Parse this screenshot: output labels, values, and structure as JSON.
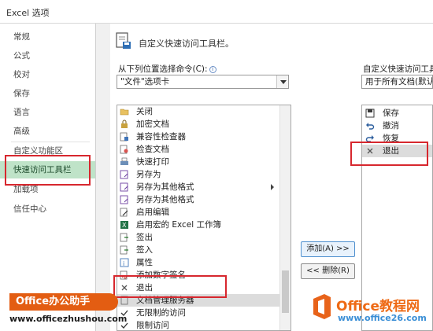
{
  "window": {
    "title": "Excel 选项"
  },
  "sidebar": {
    "items": [
      {
        "label": "常规"
      },
      {
        "label": "公式"
      },
      {
        "label": "校对"
      },
      {
        "label": "保存"
      },
      {
        "label": "语言"
      },
      {
        "label": "高级"
      },
      {
        "label": "自定义功能区"
      },
      {
        "label": "快速访问工具栏",
        "active": true
      },
      {
        "label": "加载项"
      },
      {
        "label": "信任中心"
      }
    ]
  },
  "header": {
    "title": "自定义快速访问工具栏。"
  },
  "left_panel": {
    "choose_label": "从下列位置选择命令(C):",
    "choose_value": "\"文件\"选项卡",
    "commands": [
      {
        "label": "关闭",
        "icon": "folder-icon"
      },
      {
        "label": "加密文档",
        "icon": "lock-icon"
      },
      {
        "label": "兼容性检查器",
        "icon": "compat-check-icon"
      },
      {
        "label": "检查文档",
        "icon": "inspect-doc-icon"
      },
      {
        "label": "快速打印",
        "icon": "quick-print-icon"
      },
      {
        "label": "另存为",
        "icon": "save-as-icon"
      },
      {
        "label": "另存为其他格式",
        "icon": "save-as-other-icon",
        "submenu": true
      },
      {
        "label": "另存为其他格式",
        "icon": "save-as-other-icon"
      },
      {
        "label": "启用编辑",
        "icon": "enable-edit-icon"
      },
      {
        "label": "启用宏的 Excel 工作簿",
        "icon": "excel-macro-icon"
      },
      {
        "label": "签出",
        "icon": "checkout-icon"
      },
      {
        "label": "签入",
        "icon": "checkin-icon"
      },
      {
        "label": "属性",
        "icon": "properties-icon"
      },
      {
        "label": "添加数字签名",
        "icon": "signature-icon"
      },
      {
        "label": "退出",
        "icon": "close-x-icon"
      },
      {
        "label": "文档管理服务器",
        "icon": "doc-server-icon",
        "selected": true
      },
      {
        "label": "无限制的访问",
        "icon": "checkmark-icon"
      },
      {
        "label": "限制访问",
        "icon": "checkmark-icon"
      }
    ]
  },
  "buttons": {
    "add": "添加(A) >>",
    "remove": "<< 删除(R)"
  },
  "right_panel": {
    "label": "自定义快速访问工具栏",
    "scope_value": "用于所有文档(默认",
    "items": [
      {
        "label": "保存",
        "icon": "save-icon"
      },
      {
        "label": "撤消",
        "icon": "undo-icon"
      },
      {
        "label": "恢复",
        "icon": "redo-icon"
      },
      {
        "label": "退出",
        "icon": "close-x-icon",
        "selected": true
      }
    ]
  },
  "watermarks": {
    "left_brand": "Office办公助手",
    "left_url": "www.officezhushou.com",
    "right_brand": "Office教程网",
    "right_url": "www.office26.com"
  },
  "colors": {
    "highlight_red": "#d7272e",
    "active_green": "#bfe3c8",
    "brand_orange": "#e35d12"
  }
}
